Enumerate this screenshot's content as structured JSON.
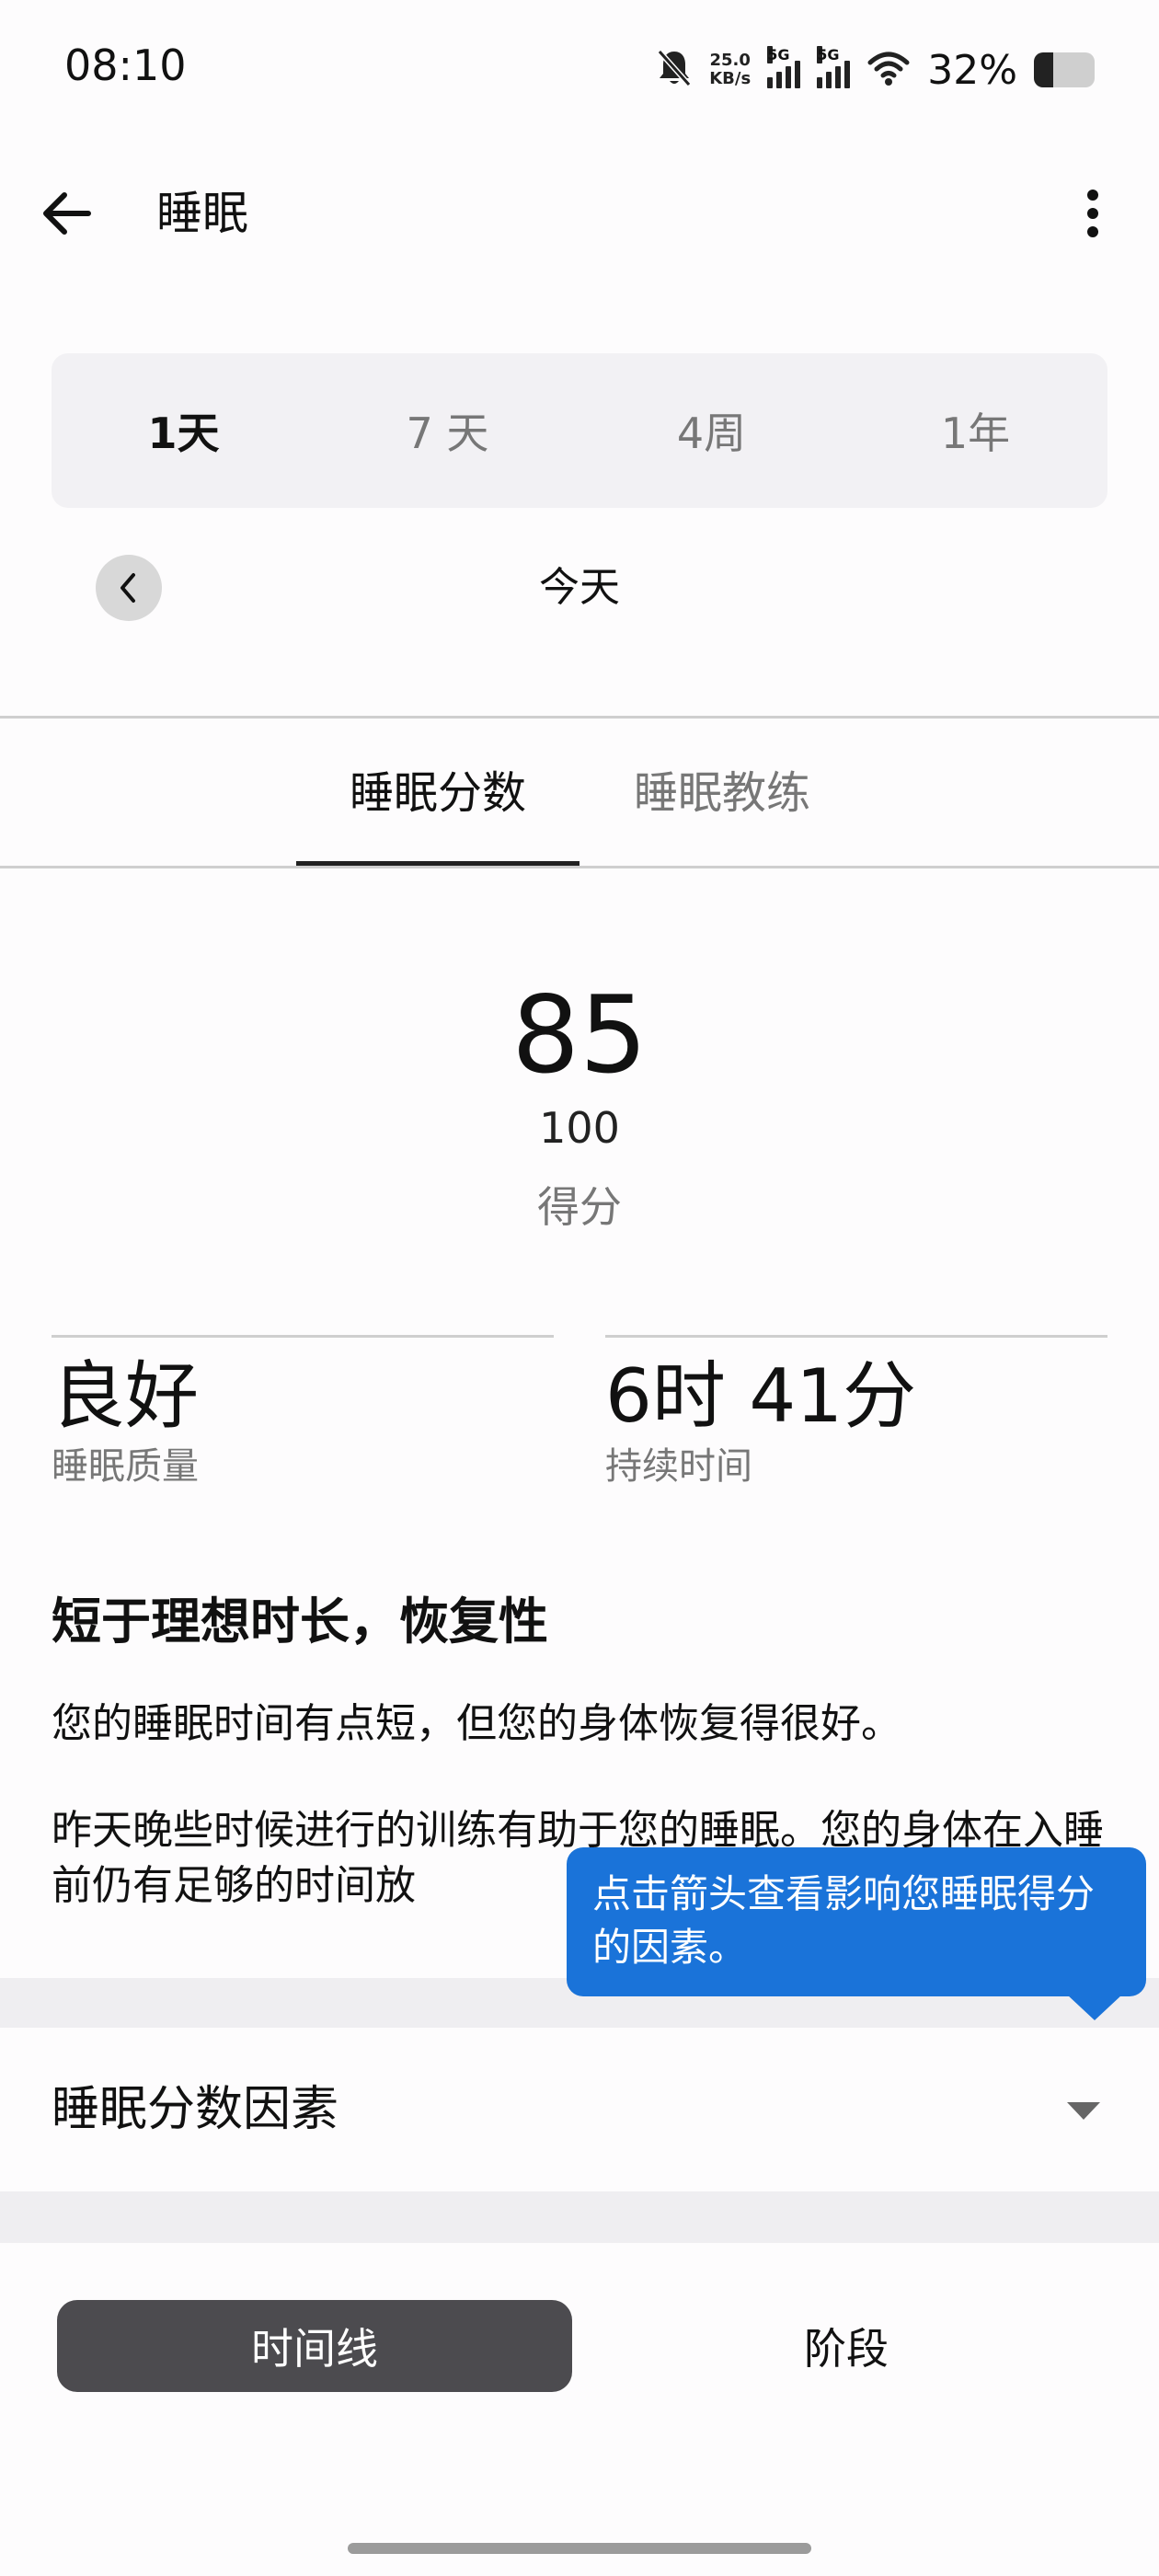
{
  "status_bar": {
    "time": "08:10",
    "net_speed_value": "25.0",
    "net_speed_unit": "KB/s",
    "signal_1_label": "5G",
    "signal_2_label": "5G",
    "battery_percent": "32%",
    "battery_level": 0.32,
    "icons": [
      "bell-off-icon",
      "signal-icon",
      "wifi-icon",
      "battery-icon"
    ]
  },
  "app_bar": {
    "title": "睡眠"
  },
  "range_tabs": [
    "1天",
    "7 天",
    "4周",
    "1年"
  ],
  "range_active": 0,
  "date_nav": {
    "label": "今天"
  },
  "content_tabs": {
    "score": "睡眠分数",
    "coach": "睡眠教练"
  },
  "score": {
    "value": "85",
    "max": "100",
    "label": "得分"
  },
  "stats": {
    "quality": {
      "value": "良好",
      "caption": "睡眠质量"
    },
    "duration": {
      "value": "6时 41分",
      "caption": "持续时间"
    }
  },
  "insight": {
    "title": "短于理想时长，恢复性",
    "p1": "您的睡眠时间有点短，但您的身体恢复得很好。",
    "p2": "昨天晚些时候进行的训练有助于您的睡眠。您的身体在入睡前仍有足够的时间放"
  },
  "tooltip": {
    "text": "点击箭头查看影响您睡眠得分的因素。"
  },
  "factors": {
    "label": "睡眠分数因素"
  },
  "view_toggle": {
    "timeline": "时间线",
    "stages": "阶段"
  },
  "colors": {
    "accent": "#1a73d9",
    "segment_dark": "#4c4b4f",
    "muted_text": "#777777"
  }
}
